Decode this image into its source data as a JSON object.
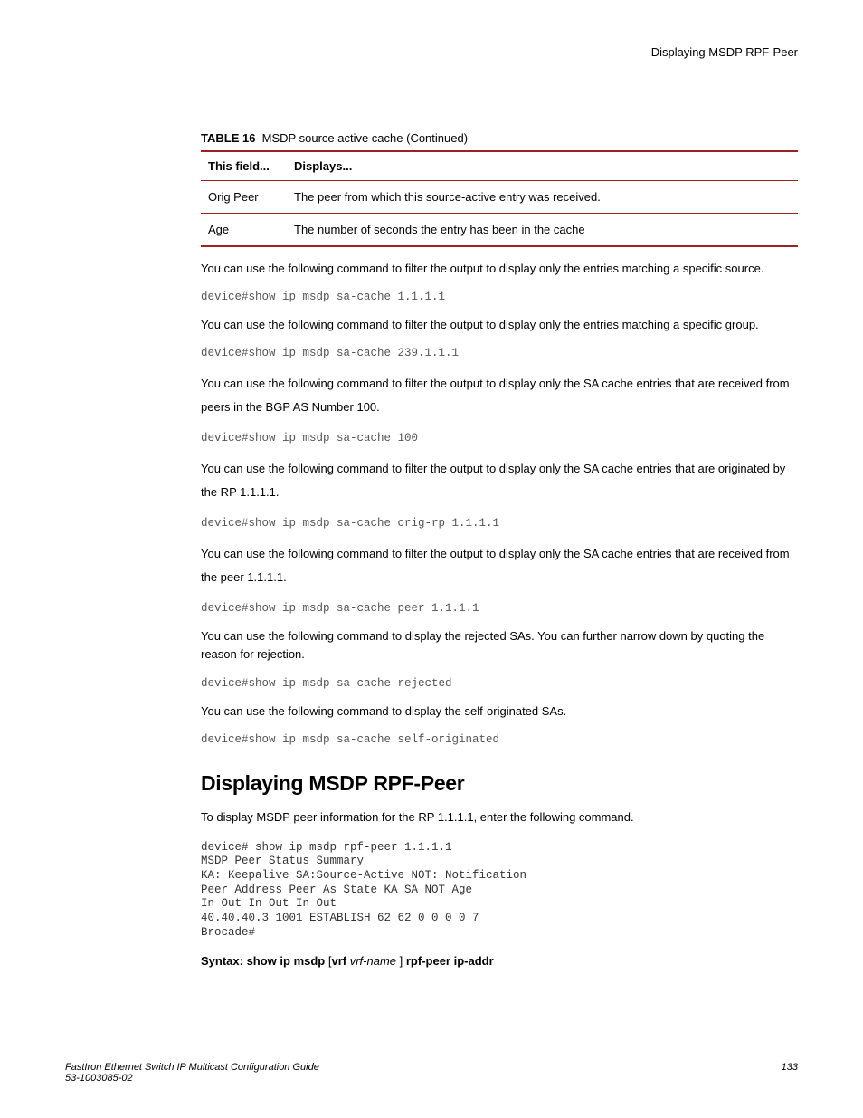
{
  "header": {
    "right_text": "Displaying MSDP RPF-Peer"
  },
  "table": {
    "caption_prefix": "TABLE 16",
    "caption_text": "MSDP source active cache (Continued)",
    "columns": {
      "c1": "This field...",
      "c2": "Displays..."
    },
    "rows": [
      {
        "field": "Orig Peer",
        "desc": "The peer from which this source-active entry was received."
      },
      {
        "field": "Age",
        "desc": "The number of seconds the entry has been in the cache"
      }
    ]
  },
  "para1": "You can use the following command to filter the output to display only the entries matching a specific source.",
  "code1": "device#show ip msdp sa-cache 1.1.1.1",
  "para2": "You can use the following command to filter the output to display only the entries matching a specific group.",
  "code2": "device#show ip msdp sa-cache 239.1.1.1",
  "para3": "You can use the following command to filter the output to display only the SA cache entries that are received from peers in the BGP AS Number 100.",
  "code3": "device#show ip msdp sa-cache 100",
  "para4": "You can use the following command to filter the output to display only the SA cache entries that are originated by the RP 1.1.1.1.",
  "code4": "device#show ip msdp sa-cache orig-rp 1.1.1.1",
  "para5": "You can use the following command to filter the output to display only the SA cache entries that are received from the peer 1.1.1.1.",
  "code5": "device#show ip msdp sa-cache peer 1.1.1.1",
  "para6": "You can use the following command to display the rejected SAs. You can further narrow down by quoting the reason for rejection.",
  "code6": "device#show ip msdp sa-cache rejected",
  "para7": "You can use the following command to display the self-originated SAs.",
  "code7": "device#show ip msdp sa-cache self-originated",
  "section_title": "Displaying MSDP RPF-Peer",
  "section_para": "To display MSDP peer information for the RP 1.1.1.1, enter the following command.",
  "section_code": "device# show ip msdp rpf-peer 1.1.1.1\nMSDP Peer Status Summary\nKA: Keepalive SA:Source-Active NOT: Notification\nPeer Address Peer As State KA SA NOT Age\nIn Out In Out In Out\n40.40.40.3 1001 ESTABLISH 62 62 0 0 0 0 7\nBrocade#",
  "syntax": {
    "prefix": "Syntax: show ip msdp",
    "bracket_open": " [",
    "vrf": "vrf",
    "vrf_name": " vrf-name ",
    "bracket_close": "] ",
    "suffix": "rpf-peer ip-addr"
  },
  "footer": {
    "title": "FastIron Ethernet Switch IP Multicast Configuration Guide",
    "docnum": "53-1003085-02",
    "page": "133"
  }
}
